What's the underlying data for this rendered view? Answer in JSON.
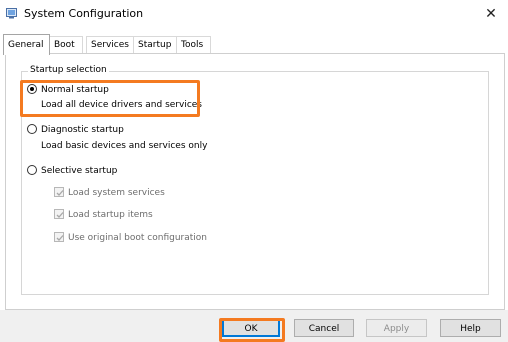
{
  "window": {
    "title": "System Configuration",
    "icon": "system-config-icon",
    "close_glyph": "✕"
  },
  "tabs": [
    {
      "label": "General",
      "active": true
    },
    {
      "label": "Boot",
      "active": false
    },
    {
      "label": "Services",
      "active": false
    },
    {
      "label": "Startup",
      "active": false
    },
    {
      "label": "Tools",
      "active": false
    }
  ],
  "startup_selection": {
    "legend": "Startup selection",
    "normal": {
      "label": "Normal startup",
      "description": "Load all device drivers and services",
      "checked": true
    },
    "diagnostic": {
      "label": "Diagnostic startup",
      "description": "Load basic devices and services only",
      "checked": false
    },
    "selective": {
      "label": "Selective startup",
      "checked": false,
      "options": [
        {
          "label": "Load system services",
          "checked": true,
          "enabled": false
        },
        {
          "label": "Load startup items",
          "checked": true,
          "enabled": false
        },
        {
          "label": "Use original boot configuration",
          "checked": true,
          "enabled": false
        }
      ]
    }
  },
  "buttons": {
    "ok": "OK",
    "cancel": "Cancel",
    "apply": "Apply",
    "help": "Help"
  },
  "colors": {
    "highlight": "#f47a20",
    "focus": "#0078d7"
  }
}
